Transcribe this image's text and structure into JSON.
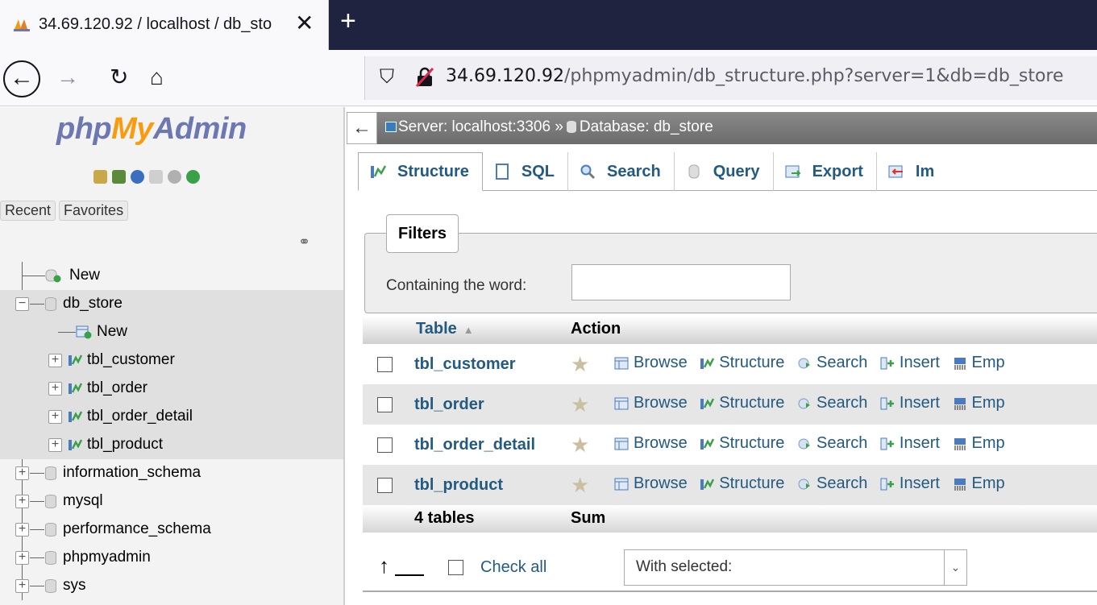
{
  "browser": {
    "tab_title": "34.69.120.92 / localhost / db_sto",
    "tab_favicon": "phpmyadmin-sail-icon",
    "url_host": "34.69.120.92",
    "url_path": "/phpmyadmin/db_structure.php?server=1&db=db_store"
  },
  "sidebar": {
    "logo_php": "php",
    "logo_my": "My",
    "logo_admin": "Admin",
    "recent_label": "Recent",
    "favorites_label": "Favorites",
    "tree": [
      {
        "label": "New",
        "level": 0,
        "type": "new"
      },
      {
        "label": "db_store",
        "level": 0,
        "type": "db",
        "expanded": true
      },
      {
        "label": "New",
        "level": 1,
        "type": "new"
      },
      {
        "label": "tbl_customer",
        "level": 1,
        "type": "table"
      },
      {
        "label": "tbl_order",
        "level": 1,
        "type": "table"
      },
      {
        "label": "tbl_order_detail",
        "level": 1,
        "type": "table"
      },
      {
        "label": "tbl_product",
        "level": 1,
        "type": "table"
      },
      {
        "label": "information_schema",
        "level": 0,
        "type": "db"
      },
      {
        "label": "mysql",
        "level": 0,
        "type": "db"
      },
      {
        "label": "performance_schema",
        "level": 0,
        "type": "db"
      },
      {
        "label": "phpmyadmin",
        "level": 0,
        "type": "db"
      },
      {
        "label": "sys",
        "level": 0,
        "type": "db"
      }
    ]
  },
  "breadcrumb": {
    "server": "Server: localhost:3306",
    "separator": "»",
    "database": "Database: db_store"
  },
  "menu": {
    "tabs": [
      {
        "label": "Structure",
        "icon": "structure-icon",
        "active": true
      },
      {
        "label": "SQL",
        "icon": "sql-icon"
      },
      {
        "label": "Search",
        "icon": "search-icon"
      },
      {
        "label": "Query",
        "icon": "query-icon"
      },
      {
        "label": "Export",
        "icon": "export-icon"
      },
      {
        "label": "Im",
        "icon": "import-icon"
      }
    ]
  },
  "filters": {
    "legend": "Filters",
    "label": "Containing the word:",
    "value": ""
  },
  "table": {
    "header_table": "Table",
    "header_action": "Action",
    "rows": [
      {
        "name": "tbl_customer"
      },
      {
        "name": "tbl_order"
      },
      {
        "name": "tbl_order_detail"
      },
      {
        "name": "tbl_product"
      }
    ],
    "actions": {
      "browse": "Browse",
      "structure": "Structure",
      "search": "Search",
      "insert": "Insert",
      "empty": "Emp"
    },
    "footer_count": "4 tables",
    "footer_sum": "Sum"
  },
  "bottom": {
    "check_all": "Check all",
    "with_selected": "With selected:"
  },
  "colors": {
    "link": "#235a81",
    "logo_php": "#6c78af",
    "logo_my": "#f89c0e",
    "tabbar": "#202340"
  }
}
